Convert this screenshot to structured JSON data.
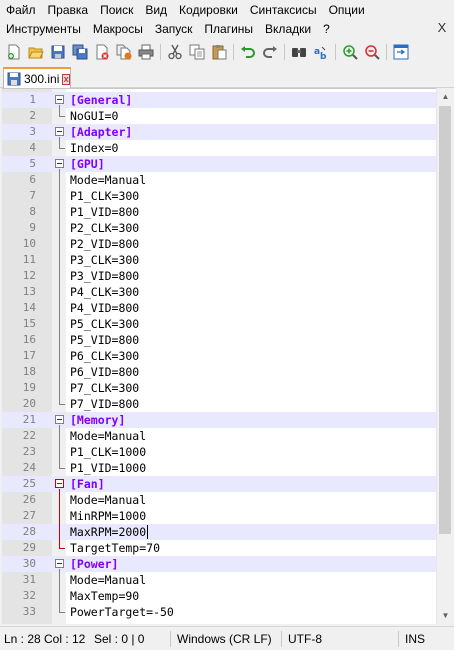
{
  "menu": {
    "row1": [
      "Файл",
      "Правка",
      "Поиск",
      "Вид",
      "Кодировки",
      "Синтаксисы",
      "Опции"
    ],
    "row2": [
      "Инструменты",
      "Макросы",
      "Запуск",
      "Плагины",
      "Вкладки",
      "?"
    ],
    "close": "X"
  },
  "toolbar": {
    "icons": [
      "new-file-icon",
      "open-file-icon",
      "save-icon",
      "save-all-icon",
      "close-icon",
      "close-all-icon",
      "print-icon",
      "cut-icon",
      "copy-icon",
      "paste-icon",
      "undo-icon",
      "redo-icon",
      "find-icon",
      "replace-icon",
      "zoom-in-icon",
      "zoom-out-icon",
      "sync-scroll-icon"
    ]
  },
  "tab": {
    "label": "300.ini",
    "close": "x"
  },
  "editor": {
    "lines": [
      {
        "n": "1",
        "text": "[General]",
        "type": "section"
      },
      {
        "n": "2",
        "text": "NoGUI=0",
        "type": "kv"
      },
      {
        "n": "3",
        "text": "[Adapter]",
        "type": "section"
      },
      {
        "n": "4",
        "text": "Index=0",
        "type": "kv"
      },
      {
        "n": "5",
        "text": "[GPU]",
        "type": "section"
      },
      {
        "n": "6",
        "text": "Mode=Manual",
        "type": "kv"
      },
      {
        "n": "7",
        "text": "P1_CLK=300",
        "type": "kv"
      },
      {
        "n": "8",
        "text": "P1_VID=800",
        "type": "kv"
      },
      {
        "n": "9",
        "text": "P2_CLK=300",
        "type": "kv"
      },
      {
        "n": "10",
        "text": "P2_VID=800",
        "type": "kv"
      },
      {
        "n": "11",
        "text": "P3_CLK=300",
        "type": "kv"
      },
      {
        "n": "12",
        "text": "P3_VID=800",
        "type": "kv"
      },
      {
        "n": "13",
        "text": "P4_CLK=300",
        "type": "kv"
      },
      {
        "n": "14",
        "text": "P4_VID=800",
        "type": "kv"
      },
      {
        "n": "15",
        "text": "P5_CLK=300",
        "type": "kv"
      },
      {
        "n": "16",
        "text": "P5_VID=800",
        "type": "kv"
      },
      {
        "n": "17",
        "text": "P6_CLK=300",
        "type": "kv"
      },
      {
        "n": "18",
        "text": "P6_VID=800",
        "type": "kv"
      },
      {
        "n": "19",
        "text": "P7_CLK=300",
        "type": "kv"
      },
      {
        "n": "20",
        "text": "P7_VID=800",
        "type": "kv"
      },
      {
        "n": "21",
        "text": "[Memory]",
        "type": "section"
      },
      {
        "n": "22",
        "text": "Mode=Manual",
        "type": "kv"
      },
      {
        "n": "23",
        "text": "P1_CLK=1000",
        "type": "kv"
      },
      {
        "n": "24",
        "text": "P1_VID=1000",
        "type": "kv"
      },
      {
        "n": "25",
        "text": "[Fan]",
        "type": "section"
      },
      {
        "n": "26",
        "text": "Mode=Manual",
        "type": "kv"
      },
      {
        "n": "27",
        "text": "MinRPM=1000",
        "type": "kv"
      },
      {
        "n": "28",
        "text": "MaxRPM=2000",
        "type": "kv"
      },
      {
        "n": "29",
        "text": "TargetTemp=70",
        "type": "kv"
      },
      {
        "n": "30",
        "text": "[Power]",
        "type": "section"
      },
      {
        "n": "31",
        "text": "Mode=Manual",
        "type": "kv"
      },
      {
        "n": "32",
        "text": "MaxTemp=90",
        "type": "kv"
      },
      {
        "n": "33",
        "text": "PowerTarget=-50",
        "type": "kv"
      }
    ],
    "current_line": "28"
  },
  "statusbar": {
    "ln": "Ln : 28",
    "col": "Col : 12",
    "sel": "Sel : 0 | 0",
    "eol": "Windows (CR LF)",
    "encoding": "UTF-8",
    "mode": "INS"
  },
  "colors": {
    "section": "#8000ff",
    "current_line_bg": "#e8e8ff",
    "gutter_bg": "#e4e4e4",
    "tab_accent": "#f29b38",
    "fold_active": "#cc0000"
  }
}
